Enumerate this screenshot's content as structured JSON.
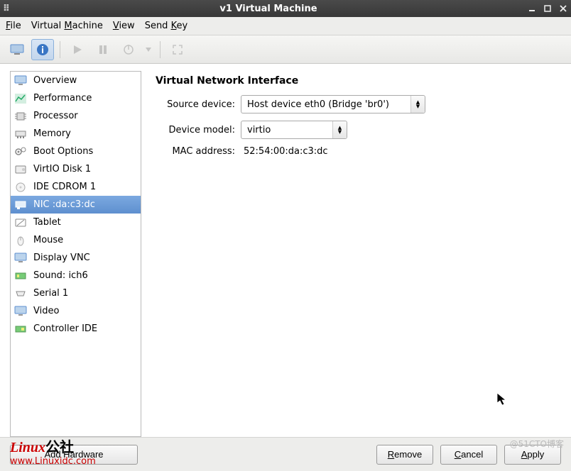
{
  "window": {
    "title": "v1 Virtual Machine"
  },
  "menu": {
    "file": "File",
    "vm": "Virtual Machine",
    "view": "View",
    "sendkey": "Send Key"
  },
  "sidebar": {
    "items": [
      {
        "label": "Overview"
      },
      {
        "label": "Performance"
      },
      {
        "label": "Processor"
      },
      {
        "label": "Memory"
      },
      {
        "label": "Boot Options"
      },
      {
        "label": "VirtIO Disk 1"
      },
      {
        "label": "IDE CDROM 1"
      },
      {
        "label": "NIC :da:c3:dc"
      },
      {
        "label": "Tablet"
      },
      {
        "label": "Mouse"
      },
      {
        "label": "Display VNC"
      },
      {
        "label": "Sound: ich6"
      },
      {
        "label": "Serial 1"
      },
      {
        "label": "Video"
      },
      {
        "label": "Controller IDE"
      }
    ],
    "selected_index": 7
  },
  "panel": {
    "heading": "Virtual Network Interface",
    "rows": {
      "source_label": "Source device:",
      "source_value": "Host device eth0 (Bridge 'br0')",
      "model_label": "Device model:",
      "model_value": "virtio",
      "mac_label": "MAC address:",
      "mac_value": "52:54:00:da:c3:dc"
    }
  },
  "buttons": {
    "add_hw": "Add Hardware",
    "remove": "Remove",
    "cancel": "Cancel",
    "apply": "Apply"
  },
  "watermark": {
    "brand": "Linux",
    "suffix": "公社",
    "url": "www.Linuxidc.com",
    "right": "@51CTO博客"
  }
}
